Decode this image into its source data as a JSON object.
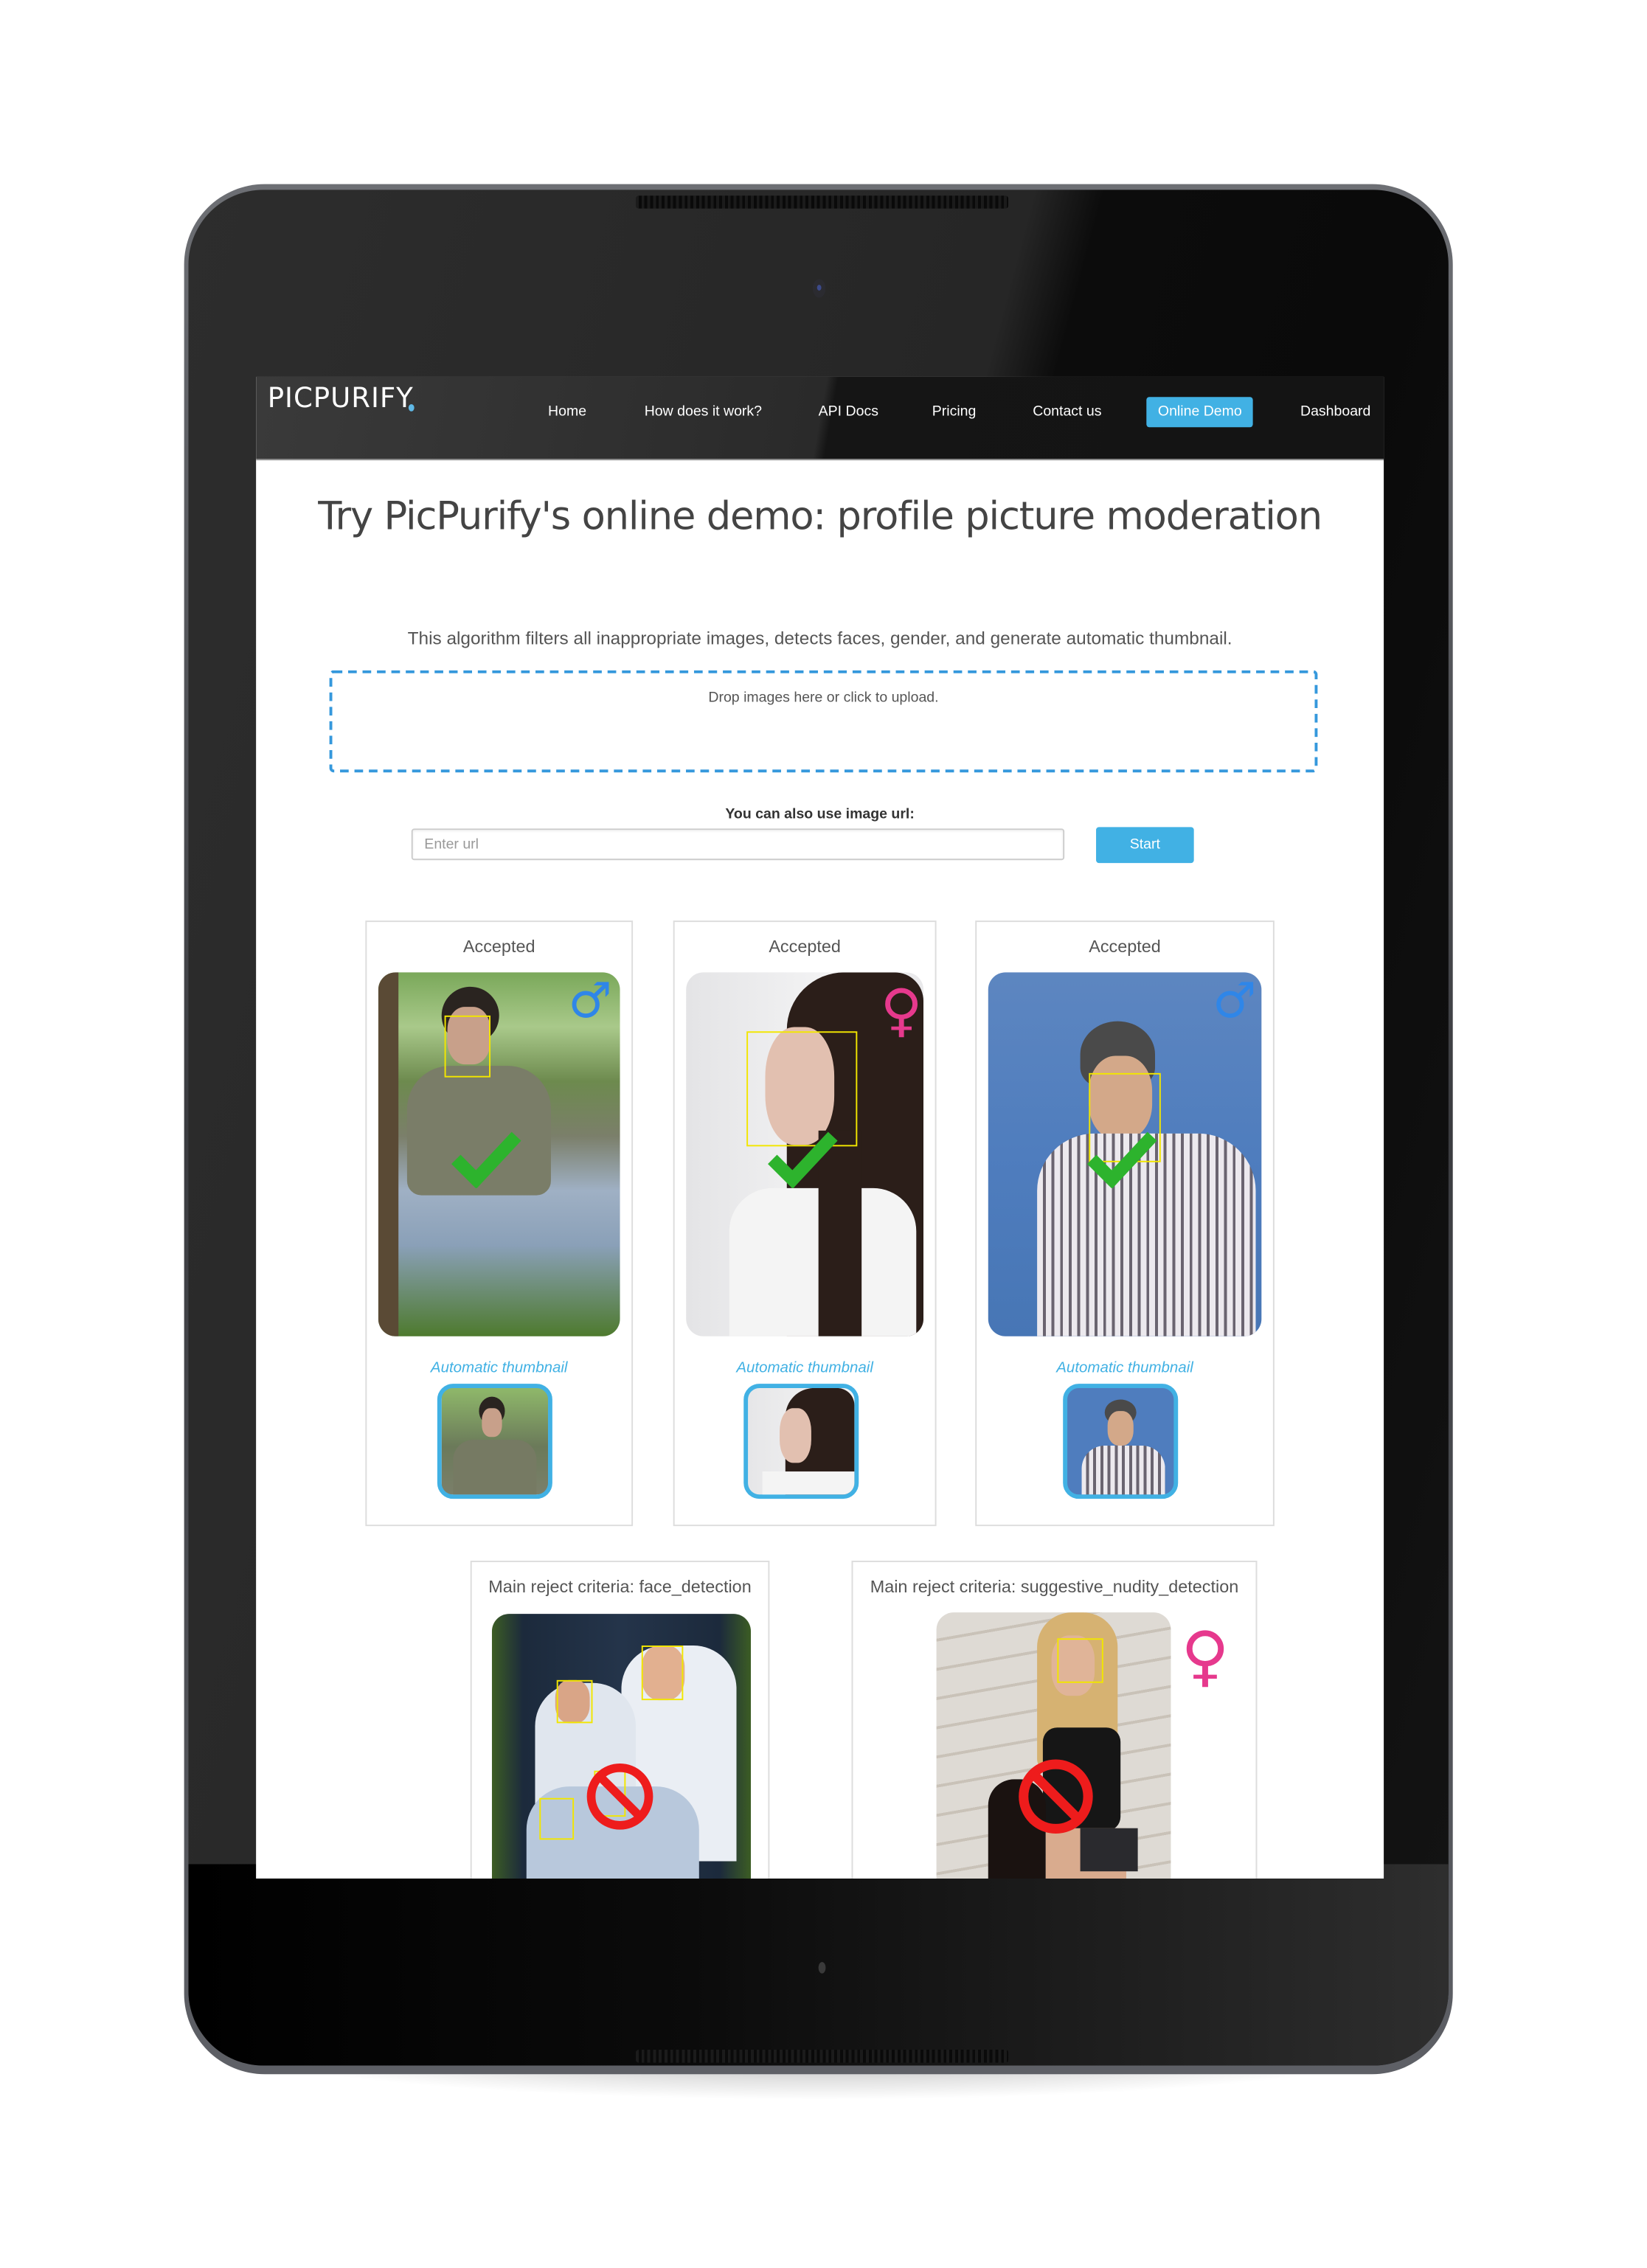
{
  "navbar": {
    "logo": "PICPURIFY",
    "items": [
      {
        "label": "Home",
        "active": false
      },
      {
        "label": "How does it work?",
        "active": false
      },
      {
        "label": "API Docs",
        "active": false
      },
      {
        "label": "Pricing",
        "active": false
      },
      {
        "label": "Contact us",
        "active": false
      },
      {
        "label": "Online Demo",
        "active": true
      },
      {
        "label": "Dashboard",
        "active": false
      }
    ]
  },
  "page": {
    "title": "Try PicPurify's online demo: profile picture moderation",
    "subtitle": "This algorithm filters all inappropriate images, detects faces, gender, and generate automatic thumbnail.",
    "dropzone_text": "Drop images here or click to upload.",
    "url_label": "You can also use image url:",
    "url_input": {
      "value": "",
      "placeholder": "Enter url"
    },
    "start_label": "Start"
  },
  "accepted_results": [
    {
      "status": "Accepted",
      "gender": "male",
      "gender_icon": "male-symbol-icon",
      "decision_icon": "green-check-icon",
      "thumbnail_label": "Automatic thumbnail"
    },
    {
      "status": "Accepted",
      "gender": "female",
      "gender_icon": "female-symbol-icon",
      "decision_icon": "green-check-icon",
      "thumbnail_label": "Automatic thumbnail"
    },
    {
      "status": "Accepted",
      "gender": "male",
      "gender_icon": "male-symbol-icon",
      "decision_icon": "green-check-icon",
      "thumbnail_label": "Automatic thumbnail"
    }
  ],
  "rejected_results": [
    {
      "title": "Main reject criteria: face_detection",
      "decision_icon": "red-prohibited-icon",
      "faces_detected": 4
    },
    {
      "title": "Main reject criteria: suggestive_nudity_detection",
      "gender": "female",
      "gender_icon": "female-symbol-icon",
      "decision_icon": "red-prohibited-icon",
      "faces_detected": 1
    }
  ],
  "symbols": {
    "male": "♂",
    "female": "♀"
  },
  "colors": {
    "accent": "#41b1e4",
    "dropzone_border": "#3598dc",
    "face_box": "#f2e600",
    "accept": "#2db32d",
    "reject": "#ee1c1c",
    "male": "#2f86e8",
    "female": "#e6398d"
  }
}
